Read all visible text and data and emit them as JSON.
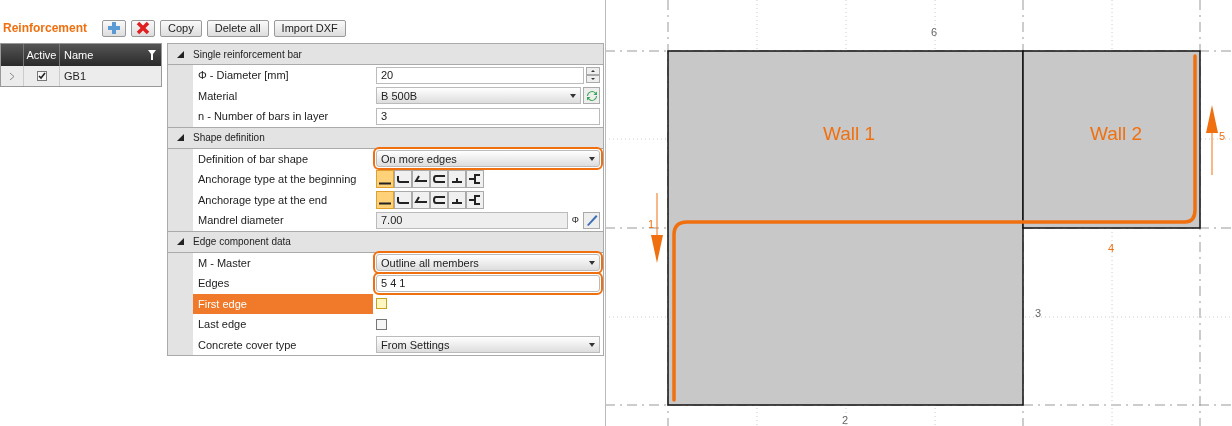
{
  "toolbar": {
    "title": "Reinforcement",
    "buttons": [
      {
        "kind": "add"
      },
      {
        "kind": "delete"
      },
      {
        "kind": "text",
        "label": "Copy"
      },
      {
        "kind": "text",
        "label": "Delete all"
      },
      {
        "kind": "text",
        "label": "Import DXF"
      }
    ]
  },
  "table": {
    "columns": [
      "Active",
      "Name"
    ],
    "rows": [
      {
        "active": true,
        "name": "GB1",
        "selected": false
      }
    ]
  },
  "property_grid": {
    "sections": [
      {
        "title": "Single reinforcement bar",
        "expanded": true,
        "rows": [
          {
            "kind": "number",
            "label": "Φ - Diameter [mm]",
            "value": "20",
            "selected": false,
            "circled": false
          },
          {
            "kind": "material",
            "label": "Material",
            "value": "B 500B",
            "selected": false,
            "circled": false
          },
          {
            "kind": "text",
            "label": "n - Number of bars in layer",
            "value": "3",
            "selected": false,
            "circled": false
          }
        ]
      },
      {
        "title": "Shape definition",
        "expanded": true,
        "rows": [
          {
            "kind": "dropdown",
            "label": "Definition of bar shape",
            "value": "On more edges",
            "selected": false,
            "circled": true
          },
          {
            "kind": "anchorage",
            "label": "Anchorage type at the beginning",
            "options": [
              {
                "kind": "straight",
                "selected": true
              },
              {
                "kind": "bend",
                "selected": false
              },
              {
                "kind": "angle",
                "selected": false
              },
              {
                "kind": "loop",
                "selected": false
              },
              {
                "kind": "plate",
                "selected": false
              },
              {
                "kind": "head",
                "selected": false
              }
            ],
            "selected": false
          },
          {
            "kind": "anchorage",
            "label": "Anchorage type at the end",
            "options": [
              {
                "kind": "straight",
                "selected": true
              },
              {
                "kind": "bend",
                "selected": false
              },
              {
                "kind": "angle",
                "selected": false
              },
              {
                "kind": "loop",
                "selected": false
              },
              {
                "kind": "plate",
                "selected": false
              },
              {
                "kind": "head",
                "selected": false
              }
            ],
            "selected": false
          },
          {
            "kind": "readonly",
            "label": "Mandrel diameter",
            "value": "7.00",
            "symbol": "Φ",
            "selected": false,
            "circled": false
          }
        ]
      },
      {
        "title": "Edge component data",
        "expanded": true,
        "rows": [
          {
            "kind": "dropdown",
            "label": "M - Master",
            "value": "Outline all members",
            "selected": false,
            "circled": true
          },
          {
            "kind": "text",
            "label": "Edges",
            "value": "5 4 1",
            "selected": false,
            "circled": true
          },
          {
            "kind": "checkbox",
            "label": "First edge",
            "checked": false,
            "selected": true
          },
          {
            "kind": "checkbox",
            "label": "Last edge",
            "checked": false,
            "selected": false
          },
          {
            "kind": "dropdown",
            "label": "Concrete cover type",
            "value": "From Settings",
            "selected": false,
            "circled": false
          }
        ]
      }
    ]
  },
  "canvas": {
    "walls": [
      {
        "label": "Wall 1"
      },
      {
        "label": "Wall 2"
      }
    ],
    "edge_labels": [
      {
        "label": "6",
        "highlighted": false
      },
      {
        "label": "4",
        "highlighted": true
      },
      {
        "label": "3",
        "highlighted": false
      },
      {
        "label": "2",
        "highlighted": false
      },
      {
        "label": "1",
        "highlighted": true
      },
      {
        "label": "5",
        "highlighted": true
      }
    ]
  }
}
